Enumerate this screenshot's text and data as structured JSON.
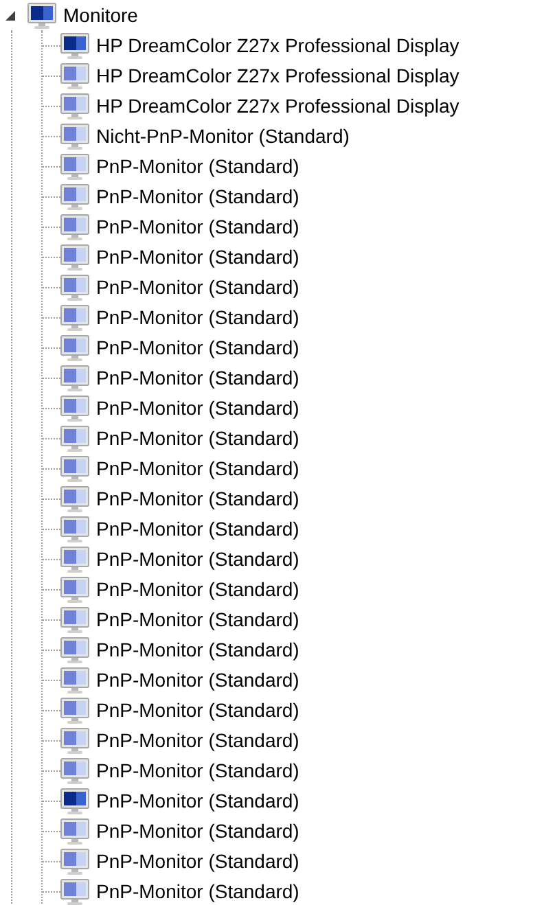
{
  "tree": {
    "label": "Monitore",
    "expanded": true,
    "present": true,
    "children": [
      {
        "label": "HP DreamColor Z27x Professional Display",
        "present": true
      },
      {
        "label": "HP DreamColor Z27x Professional Display",
        "present": false
      },
      {
        "label": "HP DreamColor Z27x Professional Display",
        "present": false
      },
      {
        "label": "Nicht-PnP-Monitor (Standard)",
        "present": false
      },
      {
        "label": "PnP-Monitor (Standard)",
        "present": false
      },
      {
        "label": "PnP-Monitor (Standard)",
        "present": false
      },
      {
        "label": "PnP-Monitor (Standard)",
        "present": false
      },
      {
        "label": "PnP-Monitor (Standard)",
        "present": false
      },
      {
        "label": "PnP-Monitor (Standard)",
        "present": false
      },
      {
        "label": "PnP-Monitor (Standard)",
        "present": false
      },
      {
        "label": "PnP-Monitor (Standard)",
        "present": false
      },
      {
        "label": "PnP-Monitor (Standard)",
        "present": false
      },
      {
        "label": "PnP-Monitor (Standard)",
        "present": false
      },
      {
        "label": "PnP-Monitor (Standard)",
        "present": false
      },
      {
        "label": "PnP-Monitor (Standard)",
        "present": false
      },
      {
        "label": "PnP-Monitor (Standard)",
        "present": false
      },
      {
        "label": "PnP-Monitor (Standard)",
        "present": false
      },
      {
        "label": "PnP-Monitor (Standard)",
        "present": false
      },
      {
        "label": "PnP-Monitor (Standard)",
        "present": false
      },
      {
        "label": "PnP-Monitor (Standard)",
        "present": false
      },
      {
        "label": "PnP-Monitor (Standard)",
        "present": false
      },
      {
        "label": "PnP-Monitor (Standard)",
        "present": false
      },
      {
        "label": "PnP-Monitor (Standard)",
        "present": false
      },
      {
        "label": "PnP-Monitor (Standard)",
        "present": false
      },
      {
        "label": "PnP-Monitor (Standard)",
        "present": false
      },
      {
        "label": "PnP-Monitor (Standard)",
        "present": true
      },
      {
        "label": "PnP-Monitor (Standard)",
        "present": false
      },
      {
        "label": "PnP-Monitor (Standard)",
        "present": false
      },
      {
        "label": "PnP-Monitor (Standard)",
        "present": false
      }
    ]
  }
}
